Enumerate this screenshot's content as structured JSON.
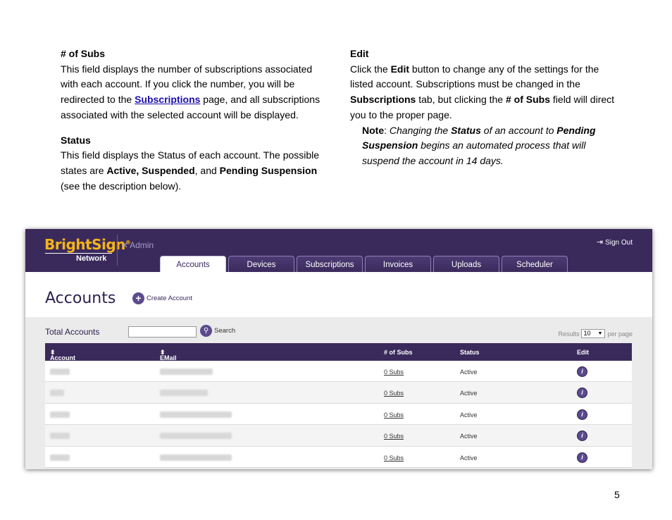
{
  "left_column": {
    "heading1": "# of Subs",
    "p1_a": "This field displays the number of subscriptions associated with each account. If you click the number, you will be redirected to the ",
    "p1_link": "Subscriptions",
    "p1_b": " page, and all subscriptions associated with the selected account will be displayed.",
    "heading2": "Status",
    "p2_a": "This field displays the Status of each account. The possible states are ",
    "p2_b1": "Active, Suspended",
    "p2_c": ", and ",
    "p2_b2": "Pending Suspension",
    "p2_d": " (see the description below)."
  },
  "right_column": {
    "heading": "Edit",
    "p_a": "Click the ",
    "p_b1": "Edit",
    "p_c": " button to change any of the settings for the listed account. Subscriptions must be changed in the ",
    "p_b2": "Subscriptions",
    "p_d": " tab, but clicking the ",
    "p_b3": "# of Subs",
    "p_e": " field will direct you to the proper page.",
    "note_label": "Note",
    "note_a": ": ",
    "note_i1": "Changing the ",
    "note_bi1": "Status",
    "note_i2": " of an account to ",
    "note_bi2": "Pending Suspension",
    "note_i3": " begins an automated process that will suspend the account in 14 days."
  },
  "app": {
    "logo": "BrightSign",
    "logo_mark": "®",
    "logo_sub": "Network",
    "admin_label": "Admin",
    "signout_label": "Sign Out",
    "tabs": [
      "Accounts",
      "Devices",
      "Subscriptions",
      "Invoices",
      "Uploads",
      "Scheduler"
    ],
    "page_title": "Accounts",
    "create_label": "Create Account",
    "total_label": "Total Accounts",
    "search_label": "Search",
    "results_label": "Results",
    "results_value": "10",
    "per_page_label": "per page",
    "columns": [
      "Account",
      "EMail",
      "# of Subs",
      "Status",
      "Edit"
    ],
    "rows": [
      {
        "subs": "0 Subs",
        "status": "Active"
      },
      {
        "subs": "0 Subs",
        "status": "Active"
      },
      {
        "subs": "0 Subs",
        "status": "Active"
      },
      {
        "subs": "0 Subs",
        "status": "Active"
      },
      {
        "subs": "0 Subs",
        "status": "Active"
      }
    ],
    "colors": {
      "brand_purple": "#3a2a5c",
      "logo_gold": "#f5b41a"
    }
  },
  "page_number": "5"
}
